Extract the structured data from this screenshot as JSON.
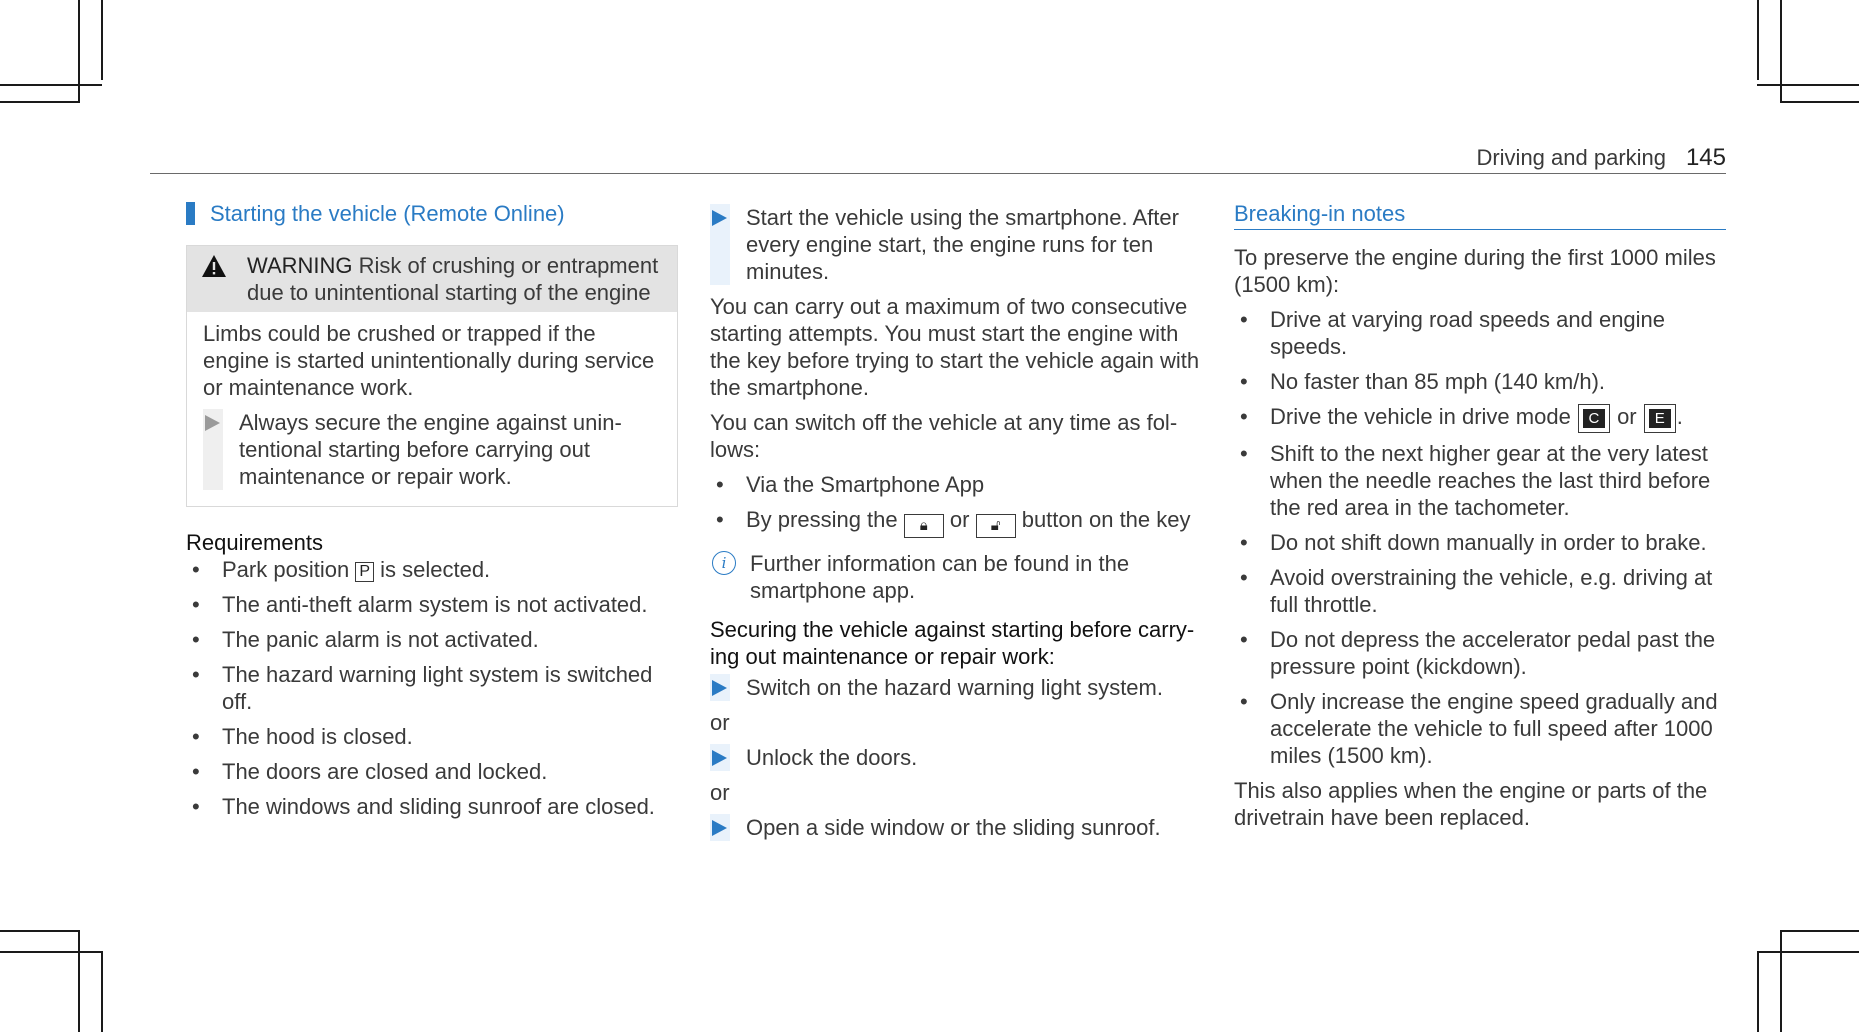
{
  "header": {
    "section": "Driving and parking",
    "page": "145"
  },
  "col1": {
    "title": "Starting the vehicle (Remote Online)",
    "warning": {
      "label": "WARNING",
      "head": "Risk of crushing or entrapment due to unintentional starting of the engine",
      "body": "Limbs could be crushed or trapped if the engine is started unintentionally during service or maintenance work.",
      "step": "Always secure the engine against unin- tentional starting before carrying out maintenance or repair work."
    },
    "requirements_title": "Requirements",
    "req1_before": "Park position",
    "park_key": "P",
    "req1_after": "is selected.",
    "requirements": [
      "The anti-theft alarm system is not activated.",
      "The panic alarm is not activated.",
      "The hazard warning light system is switched off.",
      "The hood is closed.",
      "The doors are closed and locked.",
      "The windows and sliding sunroof are closed."
    ]
  },
  "col2": {
    "step_start": "Start the vehicle using the smartphone. After every engine start, the engine runs for ten minutes.",
    "para1": "You can carry out a maximum of two consecutive starting attempts. You must start the engine with the key before trying to start the vehicle again with the smartphone.",
    "para2": "You can switch off the vehicle at any time as fol- lows:",
    "bullet1": "Via the Smartphone App",
    "bullet2_before": "By pressing the",
    "bullet2_or": "or",
    "bullet2_after": "button on the key",
    "info": "Further information can be found in the smartphone app.",
    "securing_title": "Securing the vehicle against starting before carry- ing out maintenance or repair work:",
    "step_a": "Switch on the hazard warning light system.",
    "or1": "or",
    "step_b": "Unlock the doors.",
    "or2": "or",
    "step_c": "Open a side window or the sliding sunroof."
  },
  "col3": {
    "title": "Breaking-in notes",
    "intro": "To preserve the engine during the first 1000 miles (1500 km):",
    "b1": "Drive at varying road speeds and engine speeds.",
    "b2": "No faster than 85 mph (140 km/h).",
    "b3_before": "Drive the vehicle in drive mode",
    "b3_key1": "C",
    "b3_or": "or",
    "b3_key2": "E",
    "b3_after": ".",
    "b4": "Shift to the next higher gear at the very latest when the needle reaches the last third before the red area in the tachometer.",
    "b5": "Do not shift down manually in order to brake.",
    "b6": "Avoid overstraining the vehicle, e.g. driving at full throttle.",
    "b7": "Do not depress the accelerator pedal past the pressure point (kickdown).",
    "b8": "Only increase the engine speed gradually and accelerate the vehicle to full speed after 1000 miles (1500 km).",
    "outro": "This also applies when the engine or parts of the drivetrain have been replaced."
  }
}
